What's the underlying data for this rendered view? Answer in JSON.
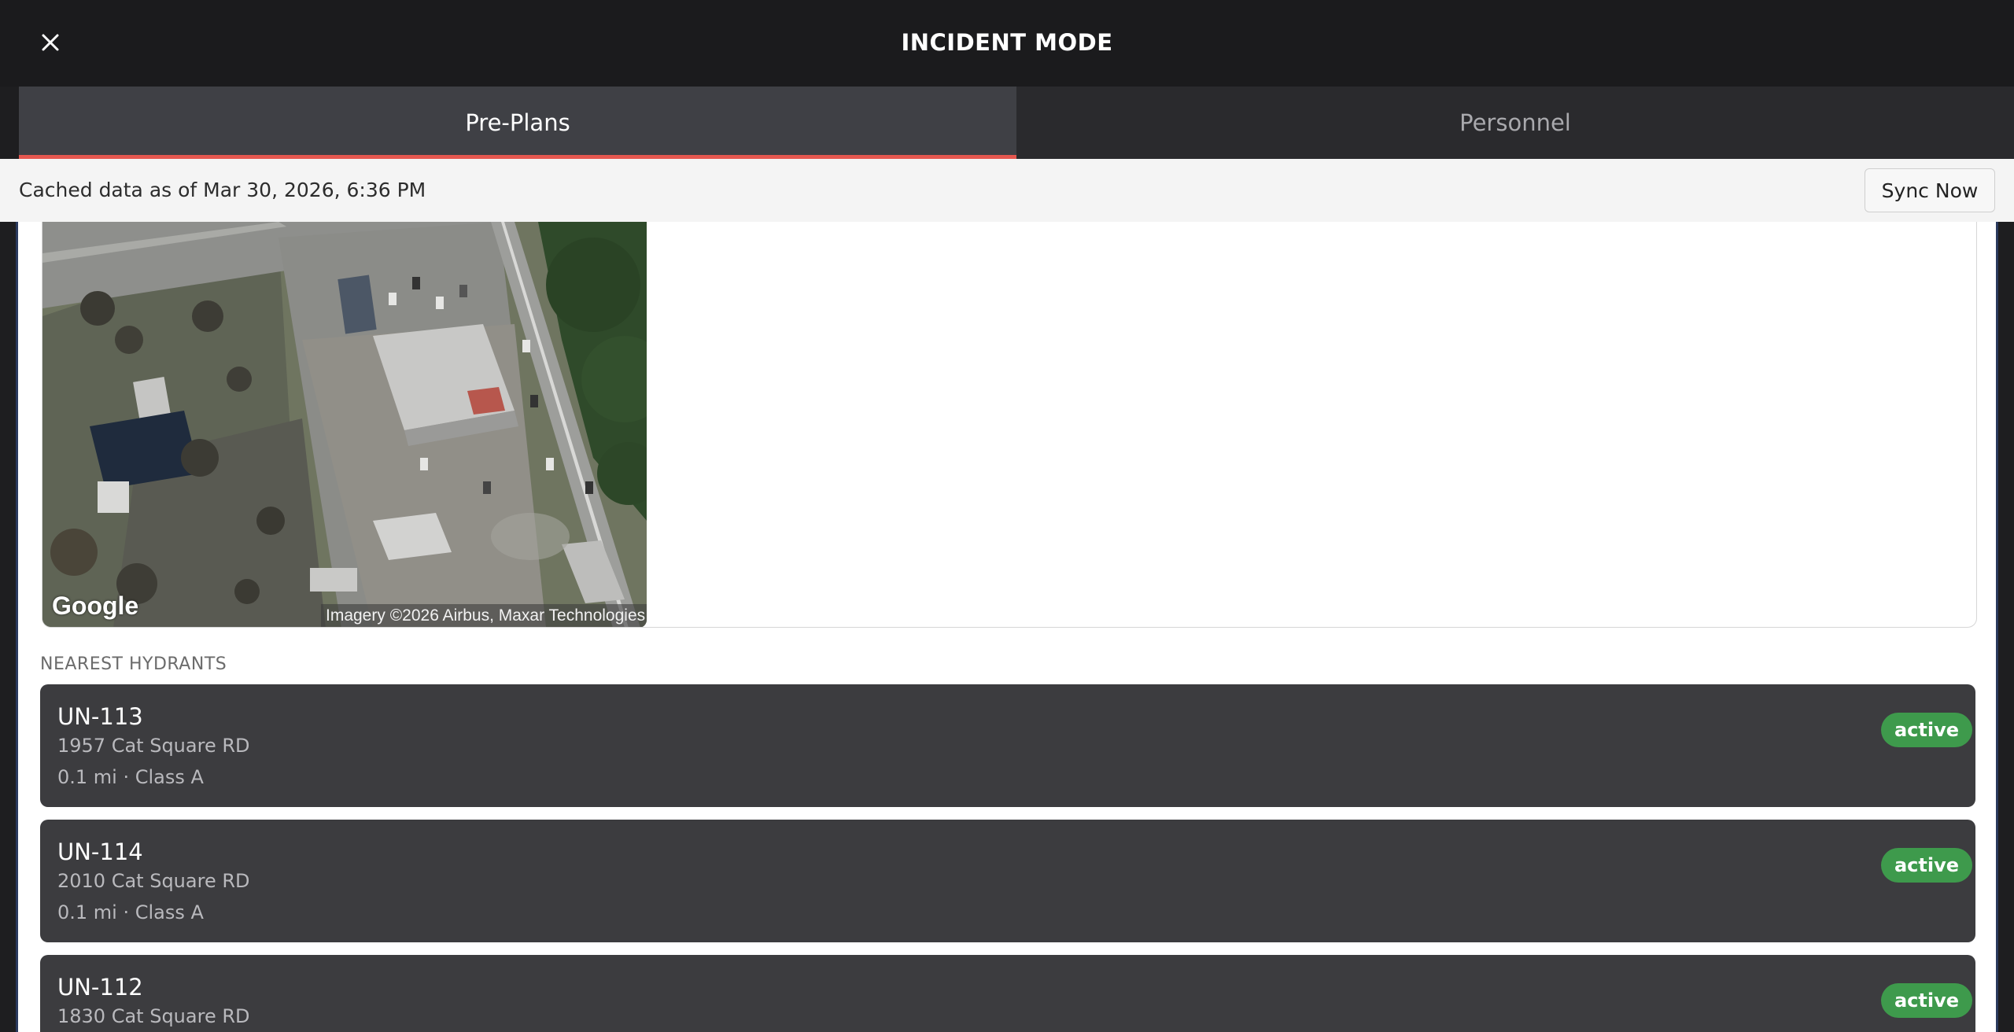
{
  "header": {
    "title": "INCIDENT MODE",
    "close_icon": "close-icon"
  },
  "tabs": [
    {
      "label": "Pre-Plans",
      "active": true
    },
    {
      "label": "Personnel",
      "active": false
    }
  ],
  "sync": {
    "status_text": "Cached data as of Mar 30, 2026, 6:36 PM",
    "button_label": "Sync Now"
  },
  "map": {
    "logo_text": "Google",
    "credit": "Imagery ©2026 Airbus, Maxar Technologies"
  },
  "hydrants": {
    "section_title": "NEAREST HYDRANTS",
    "items": [
      {
        "id": "UN-113",
        "address": "1957 Cat Square RD",
        "meta": "0.1 mi · Class A",
        "status": "active"
      },
      {
        "id": "UN-114",
        "address": "2010 Cat Square RD",
        "meta": "0.1 mi · Class A",
        "status": "active"
      },
      {
        "id": "UN-112",
        "address": "1830 Cat Square RD",
        "meta": "",
        "status": "active"
      }
    ]
  },
  "colors": {
    "accent": "#e5574f",
    "status_active": "#3e9a4c",
    "card_bg": "#3c3c3f",
    "header_bg": "#1b1b1d"
  }
}
